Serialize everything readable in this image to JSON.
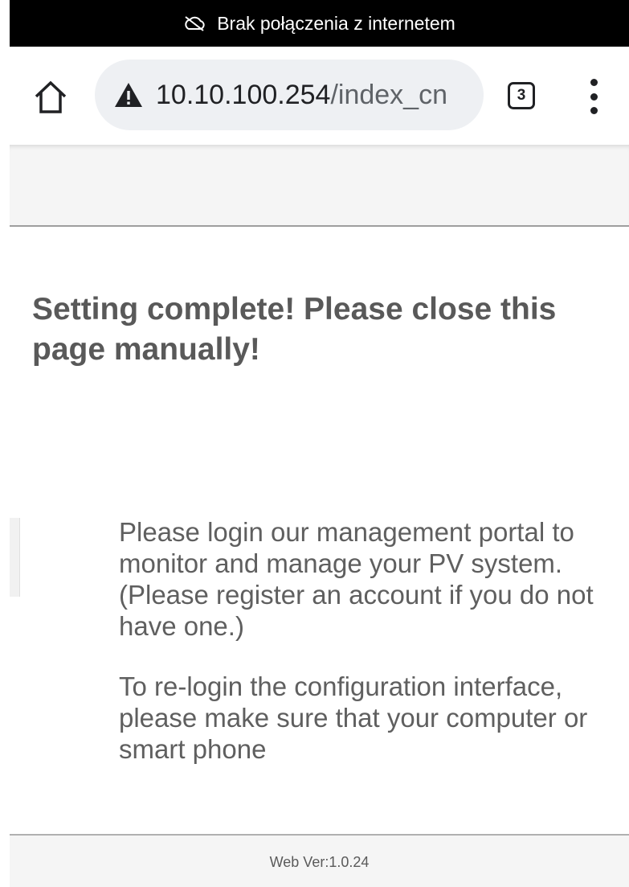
{
  "status_bar": {
    "message": "Brak połączenia z internetem",
    "icon": "cloud-off-icon"
  },
  "browser": {
    "home_icon": "home-icon",
    "security_icon": "warning-triangle-icon",
    "url_host": "10.10.100.254",
    "url_path": "/index_cn",
    "tab_count": "3",
    "menu_icon": "more-vert-icon"
  },
  "page": {
    "headline": "Setting complete! Please close this page manually!",
    "paragraphs": [
      "Please login our management portal to monitor and manage your PV system.(Please register an account if you do not have one.)",
      "To re-login the configuration interface, please make sure that your computer or smart phone"
    ],
    "footer_version": "Web Ver:1.0.24"
  },
  "colors": {
    "status_bar_bg": "#000000",
    "omnibox_bg": "#eef0f3",
    "text_gray": "#5f5f5f"
  }
}
